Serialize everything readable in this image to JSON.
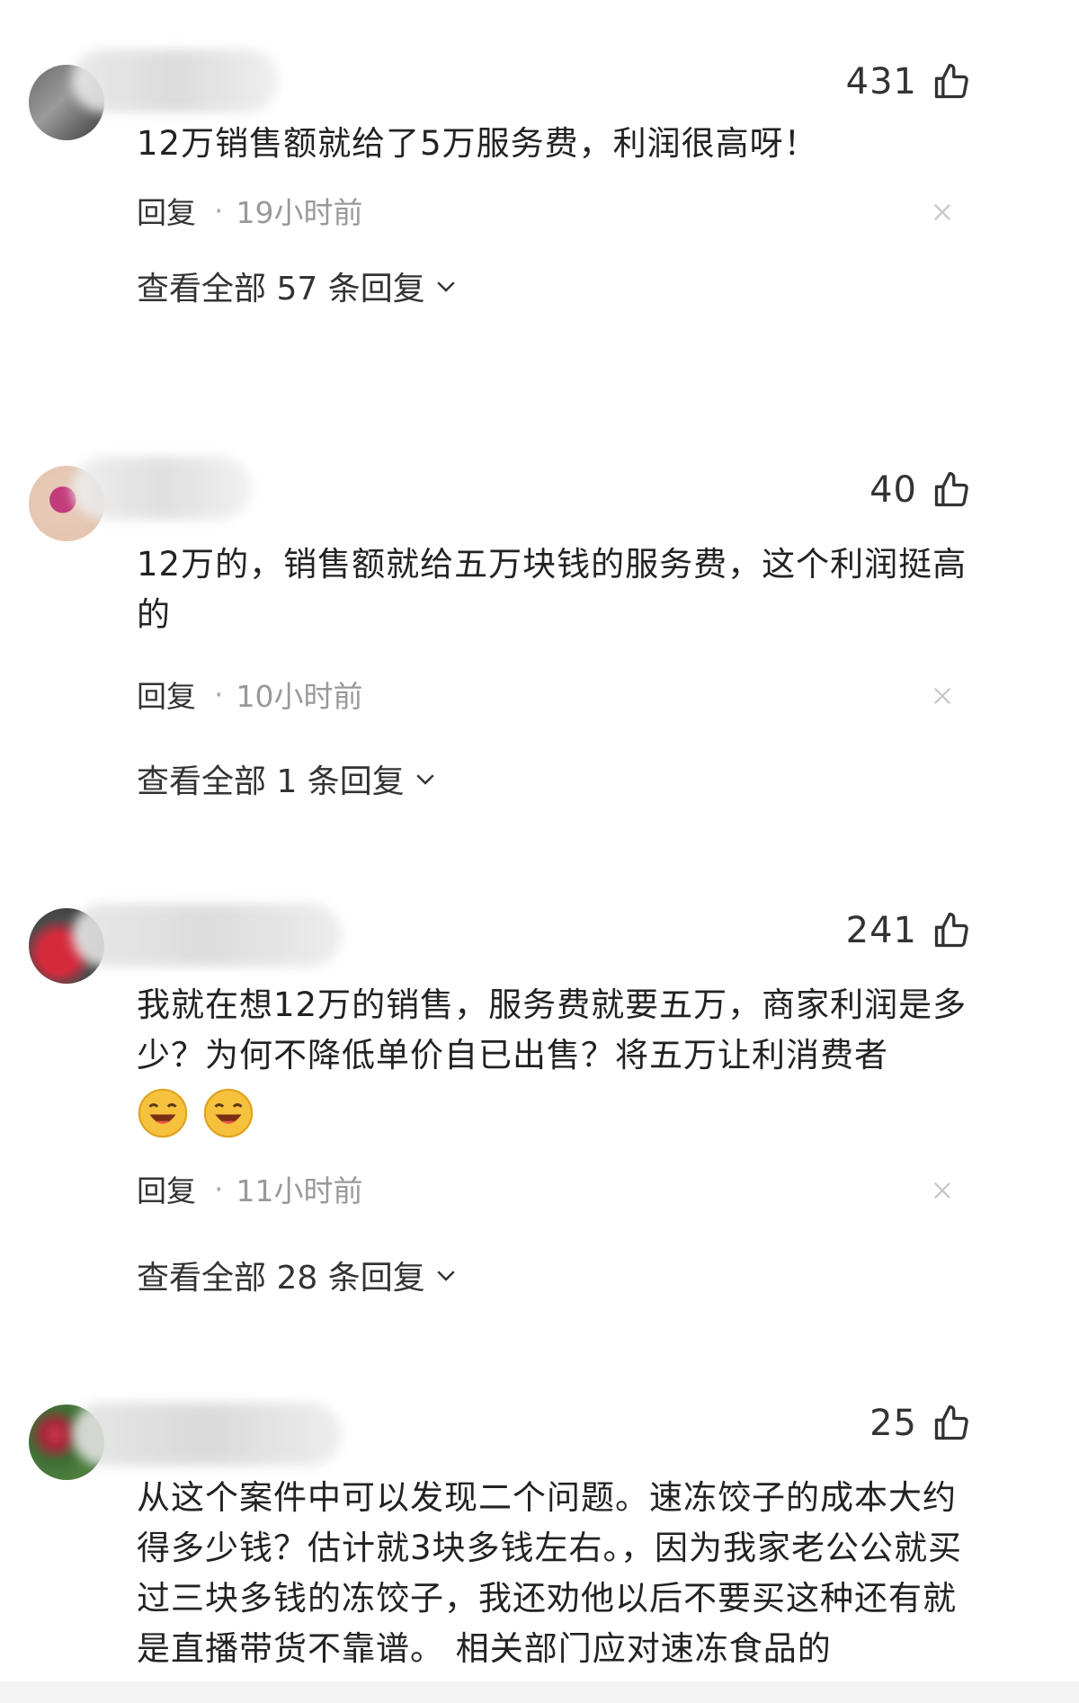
{
  "comments": [
    {
      "likes": "431",
      "text": "12万销售额就给了5万服务费，利润很高呀！",
      "reply_label": "回复",
      "separator": "·",
      "time": "19小时前",
      "view_replies": "查看全部 57 条回复"
    },
    {
      "likes": "40",
      "text": "12万的，销售额就给五万块钱的服务费，这个利润挺高的",
      "reply_label": "回复",
      "separator": "·",
      "time": "10小时前",
      "view_replies": "查看全部 1 条回复"
    },
    {
      "likes": "241",
      "text": "我就在想12万的销售，服务费就要五万，商家利润是多少？为何不降低单价自已出售？将五万让利消费者",
      "reply_label": "回复",
      "separator": "·",
      "time": "11小时前",
      "view_replies": "查看全部 28 条回复"
    },
    {
      "likes": "25",
      "text": "从这个案件中可以发现二个问题。速冻饺子的成本大约得多少钱？估计就3块多钱左右。，因为我家老公公就买过三块多钱的冻饺子，我还劝他以后不要买这种还有就是直播带货不靠谱。 相关部门应对速冻食品的"
    }
  ],
  "colors": {
    "text": "#222222",
    "muted": "#999999",
    "icon": "#333333"
  },
  "icons": {
    "like": "thumbs-up-icon",
    "close": "close-icon",
    "expand": "chevron-down-icon",
    "emoji": "laughing-face-emoji"
  }
}
